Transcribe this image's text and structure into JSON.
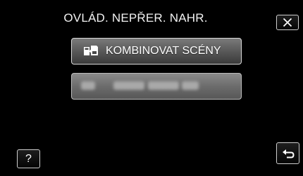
{
  "screen": {
    "title": "OVLÁD. NEPŘER. NAHR.",
    "background_color": "#000000"
  },
  "menu": {
    "items": [
      {
        "label": "KOMBINOVAT SCÉNY",
        "icon": "combine-scenes-icon",
        "state": "enabled"
      },
      {
        "label": "",
        "icon": "disabled-item-icon",
        "state": "disabled"
      }
    ]
  },
  "buttons": {
    "close_icon": "close-icon",
    "help_label": "?",
    "back_icon": "return-arrow-icon"
  },
  "colors": {
    "button_border": "#cfcfcf",
    "menu_item_active": "#5c5c5c",
    "menu_item_disabled": "#6c6c6c"
  }
}
